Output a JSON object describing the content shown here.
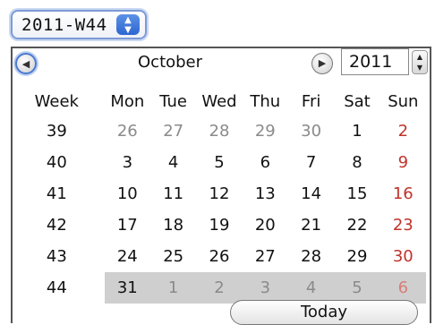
{
  "week_select": {
    "value": "2011-W44",
    "stepper_icon": "up-down-arrows"
  },
  "calendar": {
    "month": "October",
    "year": "2011",
    "prev_icon": "◀",
    "next_icon": "▶",
    "headers": [
      "Week",
      "Mon",
      "Tue",
      "Wed",
      "Thu",
      "Fri",
      "Sat",
      "Sun"
    ],
    "rows": [
      {
        "week": "39",
        "days": [
          "26",
          "27",
          "28",
          "29",
          "30",
          "1",
          "2"
        ]
      },
      {
        "week": "40",
        "days": [
          "3",
          "4",
          "5",
          "6",
          "7",
          "8",
          "9"
        ]
      },
      {
        "week": "41",
        "days": [
          "10",
          "11",
          "12",
          "13",
          "14",
          "15",
          "16"
        ]
      },
      {
        "week": "42",
        "days": [
          "17",
          "18",
          "19",
          "20",
          "21",
          "22",
          "23"
        ]
      },
      {
        "week": "43",
        "days": [
          "24",
          "25",
          "26",
          "27",
          "28",
          "29",
          "30"
        ]
      },
      {
        "week": "44",
        "days": [
          "31",
          "1",
          "2",
          "3",
          "4",
          "5",
          "6"
        ]
      }
    ],
    "today_label": "Today"
  },
  "colors": {
    "accent": "#4a78d0",
    "weekend": "#c0332b",
    "selected_row": "#cfcfcf"
  }
}
